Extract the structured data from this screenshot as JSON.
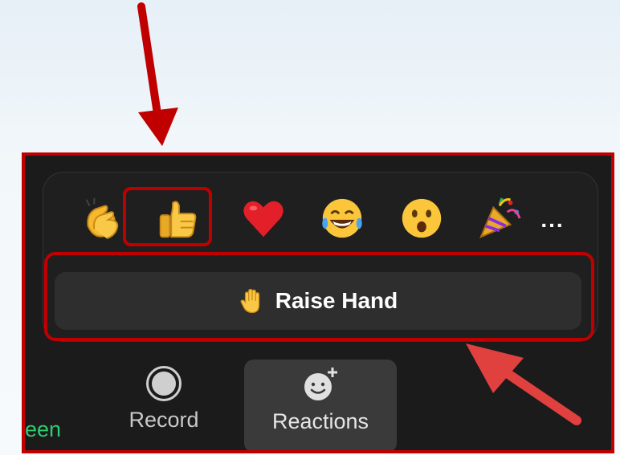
{
  "reactions_popup": {
    "emojis": [
      {
        "icon": "clapping-hands-icon"
      },
      {
        "icon": "thumbs-up-icon"
      },
      {
        "icon": "red-heart-icon"
      },
      {
        "icon": "tears-of-joy-icon"
      },
      {
        "icon": "surprised-face-icon"
      },
      {
        "icon": "party-popper-icon"
      }
    ],
    "more_label": "...",
    "raise_hand": {
      "icon": "raised-hand-icon",
      "label": "Raise Hand"
    }
  },
  "toolbar": {
    "share_partial_label": "een",
    "record_label": "Record",
    "reactions_label": "Reactions"
  },
  "colors": {
    "annotation": "#c00000",
    "arrow_accent": "#e0413f",
    "panel_bg": "#1b1b1b",
    "button_bg": "#2e2e2e",
    "share_green": "#2ecc71"
  }
}
